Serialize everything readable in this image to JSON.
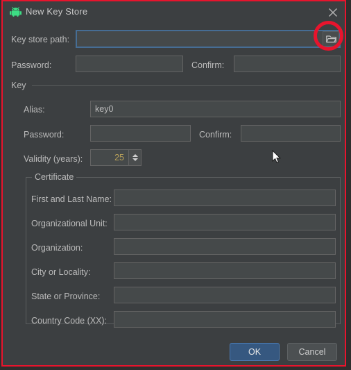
{
  "window": {
    "title": "New Key Store",
    "app_icon": "android-robot-icon",
    "close_label": "close-icon"
  },
  "colors": {
    "dialog_background": "#3c3f41",
    "field_background": "#45494a",
    "text": "#bbbbbb",
    "accent_blue": "#365880",
    "focus_border": "#466d94",
    "annotation_red": "#e8142d",
    "android_green": "#3ddc84",
    "spinner_value": "#b8a05a"
  },
  "keystore": {
    "path_label": "Key store path:",
    "path_value": "",
    "browse_icon": "folder-icon",
    "password_label": "Password:",
    "password_value": "",
    "confirm_label": "Confirm:",
    "confirm_value": ""
  },
  "key_section": {
    "title": "Key",
    "alias_label": "Alias:",
    "alias_value": "key0",
    "password_label": "Password:",
    "password_value": "",
    "confirm_label": "Confirm:",
    "confirm_value": "",
    "validity_label": "Validity (years):",
    "validity_value": "25",
    "spinner_up_icon": "chevron-up-icon",
    "spinner_down_icon": "chevron-down-icon"
  },
  "certificate": {
    "title": "Certificate",
    "fields": [
      {
        "label": "First and Last Name:",
        "value": ""
      },
      {
        "label": "Organizational Unit:",
        "value": ""
      },
      {
        "label": "Organization:",
        "value": ""
      },
      {
        "label": "City or Locality:",
        "value": ""
      },
      {
        "label": "State or Province:",
        "value": ""
      },
      {
        "label": "Country Code (XX):",
        "value": ""
      }
    ]
  },
  "buttons": {
    "ok": "OK",
    "cancel": "Cancel"
  }
}
